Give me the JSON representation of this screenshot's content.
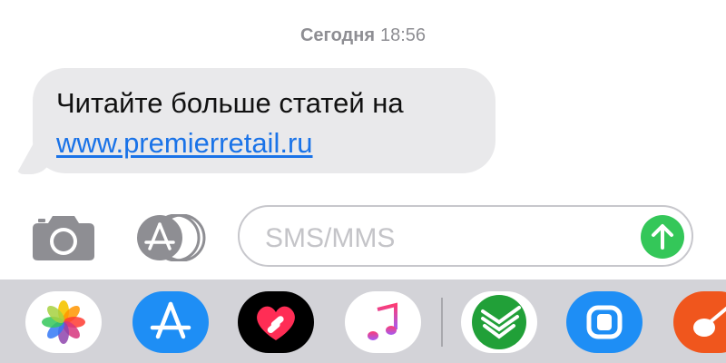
{
  "timestamp": {
    "day": "Сегодня",
    "time": "18:56"
  },
  "message": {
    "text": "Читайте больше статей на",
    "link": "www.premierretail.ru"
  },
  "composer": {
    "placeholder": "SMS/MMS",
    "camera_icon": "camera-icon",
    "appstore_icon": "app-store-icon",
    "send_icon": "arrow-up-icon"
  },
  "app_tray": {
    "apps": [
      "photos",
      "app-store",
      "digital-touch",
      "music",
      "sberbank",
      "sticker-app",
      "garageband"
    ]
  },
  "colors": {
    "bubble": "#e9e9eb",
    "link": "#1a73e8",
    "send": "#34c759",
    "tray": "#d3d3d8"
  }
}
